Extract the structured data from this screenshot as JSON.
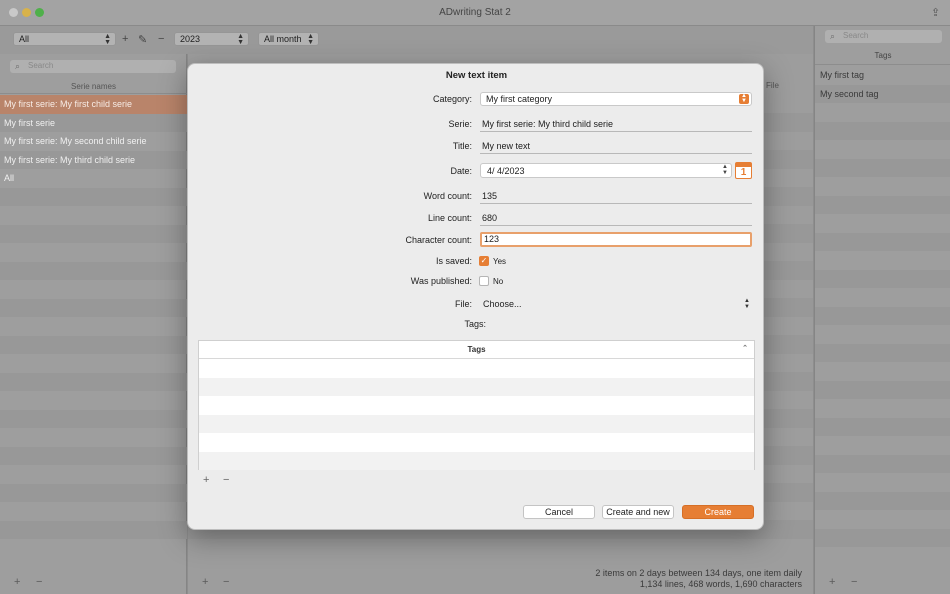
{
  "window": {
    "title": "ADwriting Stat 2"
  },
  "toolbar": {
    "filter_value": "All",
    "year_value": "2023",
    "month_value": "All month",
    "add_label": "+",
    "remove_label": "−"
  },
  "left_panel": {
    "search_placeholder": "Search",
    "column_header": "Serie names",
    "items": [
      {
        "label": "My first serie: My first child serie",
        "selected": true
      },
      {
        "label": "My first serie",
        "selected": false
      },
      {
        "label": "My first serie: My second child serie",
        "selected": false
      },
      {
        "label": "My first serie: My third child serie",
        "selected": false
      },
      {
        "label": "All",
        "selected": false
      }
    ],
    "add_label": "+",
    "remove_label": "−"
  },
  "middle": {
    "file_header": "File",
    "status_line1": "2 items on 2 days between 134 days, one item daily",
    "status_line2": "1,134 lines, 468 words, 1,690 characters",
    "add_label": "+",
    "remove_label": "−"
  },
  "right_panel": {
    "search_placeholder": "Search",
    "header": "Tags",
    "tags": [
      "My first tag",
      "My second tag"
    ],
    "add_label": "+",
    "remove_label": "−"
  },
  "dialog": {
    "title": "New text item",
    "category": {
      "label": "Category:",
      "value": "My first category"
    },
    "serie": {
      "label": "Serie:",
      "value": "My first serie: My third child serie"
    },
    "title_field": {
      "label": "Title:",
      "value": "My new text"
    },
    "date": {
      "label": "Date:",
      "value": "4/  4/2023",
      "calendar_day": "1"
    },
    "word_count": {
      "label": "Word count:",
      "value": "135"
    },
    "line_count": {
      "label": "Line count:",
      "value": "680"
    },
    "char_count": {
      "label": "Character count:",
      "value": "123"
    },
    "is_saved": {
      "label": "Is saved:",
      "option": "Yes",
      "checked": true
    },
    "was_published": {
      "label": "Was published:",
      "option": "No",
      "checked": false
    },
    "file": {
      "label": "File:",
      "value": "Choose..."
    },
    "tags_label": "Tags:",
    "tags_table_header": "Tags",
    "add_label": "+",
    "remove_label": "−",
    "buttons": {
      "cancel": "Cancel",
      "create_and_new": "Create and new",
      "create": "Create"
    }
  },
  "colors": {
    "accent": "#e67e34",
    "selection": "#b9846a",
    "dim_background": "#8e8e8e"
  }
}
